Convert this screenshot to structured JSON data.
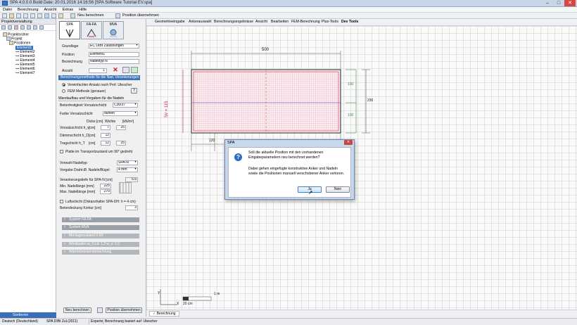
{
  "window": {
    "title": "SPA 4.0.0.0   Build Date: 20.01.2016 14:16:56   [SPA Software Tutorial EV.spa]",
    "min": "–",
    "max": "□",
    "close": "✕"
  },
  "menu": [
    "Datei",
    "Berechnung",
    "Ansicht",
    "Extras",
    "Hilfe"
  ],
  "toolbar": {
    "new_calc": "Neu berechnen",
    "apply_pos": "Position übernehmen"
  },
  "project_panel": {
    "header": "Projektverwaltung",
    "tree": [
      "Projektordner",
      "Projekt",
      "Positionen",
      "Element1",
      "Element2",
      "Element3",
      "Element4",
      "Element5",
      "Element6",
      "Element7"
    ],
    "sort_label": "Sortieren"
  },
  "tabs": [
    {
      "label": "SPA"
    },
    {
      "label": "FA-FA"
    },
    {
      "label": "MVA"
    }
  ],
  "form": {
    "grundlage_label": "Grundlage",
    "grundlage_value": "EC DIBt Zulassungen",
    "position_label": "Position",
    "position_value": "Element1",
    "bezeichnung_label": "Bezeichnung",
    "bezeichnung_value": "Nadeltyp N",
    "anzahl_label": "Anzahl",
    "anzahl_value": "1",
    "method_header": "Berechnungsmethode für die Nad. Verankerungen",
    "method_opt1": "Vereinfachter Ansatz nach Prof. Utescher",
    "method_opt2": "FEM Methode (genauer)",
    "method_help": "?",
    "wall_header": "Wandaufbau und Vorgaben für die Nadeln",
    "beton_label": "Betonfestigkeit Vorsatzschicht",
    "beton_value": "C30/37",
    "farbe_label": "Farbe Vorsatzschicht",
    "farbe_value": "dunkel",
    "thick_hdr_d": "Dicke [cm]",
    "thick_hdr_w": "Wichte",
    "thick_hdr_unit": "[kN/m³]",
    "rows": [
      {
        "label": "Vorsatzschicht h_v",
        "unit": "[cm]",
        "d": "7",
        "w": "25"
      },
      {
        "label": "Dämmschicht h_D",
        "unit": "[cm]",
        "d": "12",
        "w": ""
      },
      {
        "label": "Tragschicht h_T",
        "unit": "[cm]",
        "d": "12",
        "w": "25"
      }
    ],
    "transport_label": "Platte im Transportzustand um 90° gedreht",
    "nadel_label": "Vorwahl Nadeltyp",
    "nadel_value": "SPA-N",
    "draht_label": "Vorgabe Draht-Ø. Nadeln/Bügel",
    "draht_value": "4 mm",
    "vtiefe_label": "Verankerungstiefe für SPA-N  [cm]",
    "vtiefe_value": "5.5",
    "minlen_label": "Min. Nadellänge [mm]",
    "minlen_value": "225",
    "maxlen_label": "Max. Nadellänge [mm]",
    "maxlen_value": "270",
    "luft_label": "Luftschicht (Distanzhalter SPA-DH: h = 4 cm)",
    "kontur_label": "Betondeckung Kontur  [cm]",
    "kontur_value": "3",
    "groups": [
      "System FA-FA",
      "System MVA",
      "Montagezustand     0 kN",
      "Windlasten    w_0,Ld: 1,2     w_s: 1,0",
      "Wärmebrückenbetrachtung"
    ],
    "btn_new": "Neu berechnen",
    "btn_apply": "Position übernehmen"
  },
  "ribbon": [
    "Geometrieeingabe",
    "Ankerauswahl",
    "Berechnungsergebnisse",
    "Ansicht",
    "Bearbeiten",
    "FEM-Berechnung",
    "Plus-Tools",
    "Dev Tools"
  ],
  "drawing": {
    "dim_width": "500",
    "dim_right_top": "100",
    "dim_right_bottom": "100",
    "dim_total": "230",
    "dim_left": "Sv = 115",
    "dim_bottom": "120",
    "scale_label": "1 m",
    "scale_small": "20 cm",
    "axis_y": "Y",
    "axis_x": "X",
    "accent": "#d4183d"
  },
  "dialog": {
    "title": "SPA",
    "question1": "Soll die aktuelle Position mit den vorhandenen",
    "question2": "Eingabeparametern neu berechnet werden?",
    "info1": "Dabei gehen eingefügte konstruktive Anker und Nadeln",
    "info2": "sowie die Positionen manuell verschobener Anker verloren.",
    "yes": "Ja",
    "no": "Nein"
  },
  "bottom_tab": "Berechnung",
  "status": {
    "language": "Deutsch (Deutschland)",
    "norm": "SPA DIBt Zul.(2011)",
    "mode": "Experte",
    "basis": "Berechnung basiert auf:  Utescher"
  }
}
